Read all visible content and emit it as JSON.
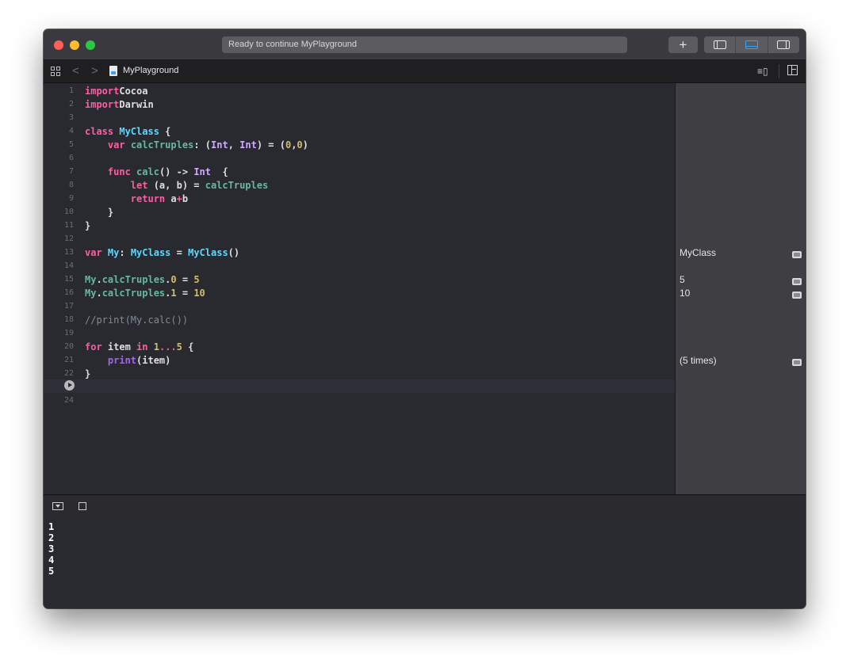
{
  "window": {
    "activity_text": "Ready to continue MyPlayground",
    "add_label": "+"
  },
  "jumpbar": {
    "file_name": "MyPlayground",
    "back_label": "<",
    "forward_label": ">"
  },
  "editor": {
    "line_numbers": [
      "1",
      "2",
      "3",
      "4",
      "5",
      "6",
      "7",
      "8",
      "9",
      "10",
      "11",
      "12",
      "13",
      "14",
      "15",
      "16",
      "17",
      "18",
      "19",
      "20",
      "21",
      "22",
      "",
      "24"
    ],
    "current_line": "23",
    "lines": [
      [
        [
          "kw",
          "import"
        ],
        [
          "",
          "Cocoa"
        ]
      ],
      [
        [
          "kw",
          "import"
        ],
        [
          "",
          "Darwin"
        ]
      ],
      [],
      [
        [
          "kw",
          "class"
        ],
        [
          "",
          " "
        ],
        [
          "cls",
          "MyClass"
        ],
        [
          "",
          " {"
        ]
      ],
      [
        [
          ""
        ],
        [
          "    "
        ],
        [
          "kw",
          "var"
        ],
        [
          "",
          " "
        ],
        [
          "var",
          "calcTruples"
        ],
        [
          "",
          ": ("
        ],
        [
          "ty",
          "Int"
        ],
        [
          "",
          ", "
        ],
        [
          "ty",
          "Int"
        ],
        [
          "",
          ") = ("
        ],
        [
          "num",
          "0"
        ],
        [
          "",
          ","
        ],
        [
          "num",
          "0"
        ],
        [
          "",
          ")"
        ]
      ],
      [],
      [
        [
          "",
          "    "
        ],
        [
          "kw",
          "func"
        ],
        [
          "",
          " "
        ],
        [
          "fn",
          "calc"
        ],
        [
          "",
          "() -> "
        ],
        [
          "ty",
          "Int"
        ],
        [
          "",
          "  {"
        ]
      ],
      [
        [
          "",
          "        "
        ],
        [
          "kw",
          "let"
        ],
        [
          "",
          " (a, b) = "
        ],
        [
          "var",
          "calcTruples"
        ]
      ],
      [
        [
          "",
          "        "
        ],
        [
          "kw",
          "return"
        ],
        [
          "",
          " a"
        ],
        [
          "kw",
          "+"
        ],
        [
          "",
          "b"
        ]
      ],
      [
        [
          "",
          "    }"
        ]
      ],
      [
        [
          "",
          "}"
        ]
      ],
      [],
      [
        [
          "kw",
          "var"
        ],
        [
          "",
          " "
        ],
        [
          "cls",
          "My"
        ],
        [
          "",
          ": "
        ],
        [
          "cls",
          "MyClass"
        ],
        [
          "",
          " = "
        ],
        [
          "cls",
          "MyClass"
        ],
        [
          "",
          "()"
        ]
      ],
      [],
      [
        [
          "var",
          "My"
        ],
        [
          "",
          "."
        ],
        [
          "var",
          "calcTruples"
        ],
        [
          "",
          "."
        ],
        [
          "num",
          "0"
        ],
        [
          "",
          " = "
        ],
        [
          "num",
          "5"
        ]
      ],
      [
        [
          "var",
          "My"
        ],
        [
          "",
          "."
        ],
        [
          "var",
          "calcTruples"
        ],
        [
          "",
          "."
        ],
        [
          "num",
          "1"
        ],
        [
          "",
          " = "
        ],
        [
          "num",
          "10"
        ]
      ],
      [],
      [
        [
          "cm",
          "//print(My.calc())"
        ]
      ],
      [],
      [
        [
          "kw",
          "for"
        ],
        [
          "",
          " item "
        ],
        [
          "kw",
          "in"
        ],
        [
          "",
          " "
        ],
        [
          "num",
          "1"
        ],
        [
          "kw",
          "..."
        ],
        [
          "num",
          "5"
        ],
        [
          "",
          " {"
        ]
      ],
      [
        [
          "",
          "    "
        ],
        [
          "tyd",
          "print"
        ],
        [
          "",
          "(item)"
        ]
      ],
      [
        [
          "",
          "}"
        ]
      ],
      [],
      []
    ]
  },
  "results": [
    {
      "line": 13,
      "text": "MyClass"
    },
    {
      "line": 15,
      "text": "5"
    },
    {
      "line": 16,
      "text": "10"
    },
    {
      "line": 21,
      "text": "(5 times)"
    }
  ],
  "console": {
    "lines": [
      "1",
      "2",
      "3",
      "4",
      "5"
    ]
  },
  "colors": {
    "keyword": "#fc5fa3",
    "class": "#5dd8ff",
    "variable": "#67b7a4",
    "number": "#d0bf69",
    "type": "#d0a8ff",
    "accent": "#2aa3ff"
  }
}
